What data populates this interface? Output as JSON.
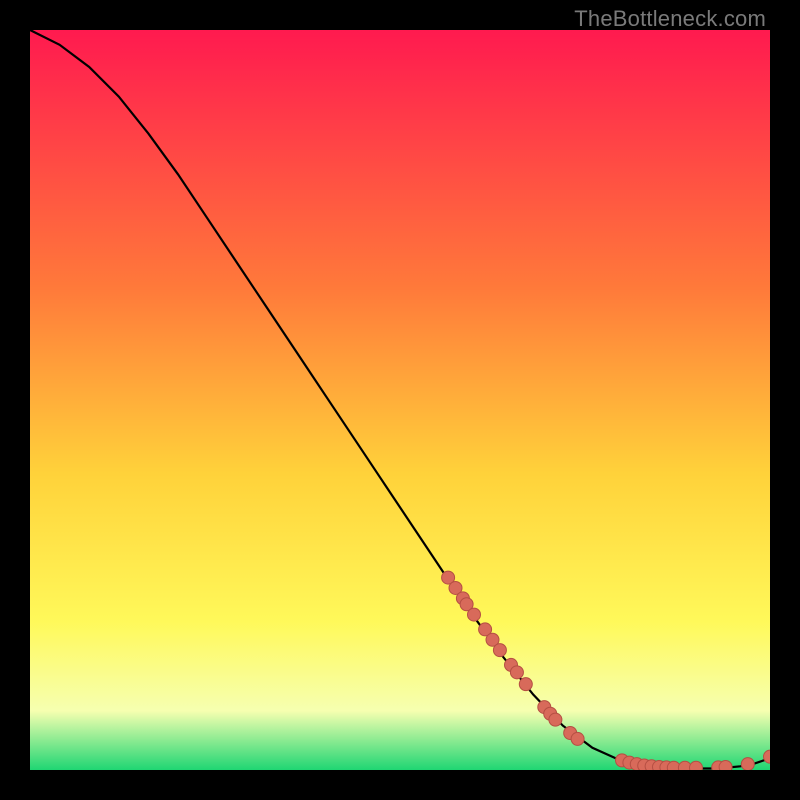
{
  "watermark": "TheBottleneck.com",
  "colors": {
    "bg": "#000000",
    "grad_top": "#ff1a4f",
    "grad_mid1": "#ff7a3a",
    "grad_mid2": "#ffd23a",
    "grad_mid3": "#fff95a",
    "grad_mid4": "#f6ffb0",
    "grad_bottom": "#1fd673",
    "curve": "#000000",
    "marker_fill": "#d86a5a",
    "marker_stroke": "#b54f43"
  },
  "chart_data": {
    "type": "line",
    "title": "",
    "xlabel": "",
    "ylabel": "",
    "xlim": [
      0,
      100
    ],
    "ylim": [
      0,
      100
    ],
    "series": [
      {
        "name": "curve",
        "x": [
          0,
          4,
          8,
          12,
          16,
          20,
          24,
          28,
          32,
          36,
          40,
          44,
          48,
          52,
          56,
          60,
          64,
          68,
          72,
          76,
          80,
          82,
          84,
          86,
          88,
          90,
          92,
          94,
          96,
          98,
          100
        ],
        "y": [
          100,
          98,
          95,
          91,
          86,
          80.5,
          74.5,
          68.5,
          62.5,
          56.5,
          50.5,
          44.5,
          38.5,
          32.5,
          26.5,
          20.7,
          15.2,
          10.2,
          6.0,
          3.0,
          1.2,
          0.7,
          0.4,
          0.25,
          0.2,
          0.2,
          0.2,
          0.3,
          0.5,
          0.9,
          1.6
        ]
      }
    ],
    "markers": [
      {
        "x": 56.5,
        "y": 26.0
      },
      {
        "x": 57.5,
        "y": 24.6
      },
      {
        "x": 58.5,
        "y": 23.2
      },
      {
        "x": 59.0,
        "y": 22.4
      },
      {
        "x": 60.0,
        "y": 21.0
      },
      {
        "x": 61.5,
        "y": 19.0
      },
      {
        "x": 62.5,
        "y": 17.6
      },
      {
        "x": 63.5,
        "y": 16.2
      },
      {
        "x": 65.0,
        "y": 14.2
      },
      {
        "x": 65.8,
        "y": 13.2
      },
      {
        "x": 67.0,
        "y": 11.6
      },
      {
        "x": 69.5,
        "y": 8.5
      },
      {
        "x": 70.3,
        "y": 7.6
      },
      {
        "x": 71.0,
        "y": 6.8
      },
      {
        "x": 73.0,
        "y": 5.0
      },
      {
        "x": 74.0,
        "y": 4.2
      },
      {
        "x": 80.0,
        "y": 1.3
      },
      {
        "x": 81.0,
        "y": 1.0
      },
      {
        "x": 82.0,
        "y": 0.8
      },
      {
        "x": 83.0,
        "y": 0.6
      },
      {
        "x": 84.0,
        "y": 0.5
      },
      {
        "x": 85.0,
        "y": 0.4
      },
      {
        "x": 86.0,
        "y": 0.35
      },
      {
        "x": 87.0,
        "y": 0.3
      },
      {
        "x": 88.5,
        "y": 0.3
      },
      {
        "x": 90.0,
        "y": 0.3
      },
      {
        "x": 93.0,
        "y": 0.35
      },
      {
        "x": 94.0,
        "y": 0.4
      },
      {
        "x": 97.0,
        "y": 0.8
      },
      {
        "x": 100.0,
        "y": 1.8
      }
    ],
    "marker_radius": 6.5
  }
}
